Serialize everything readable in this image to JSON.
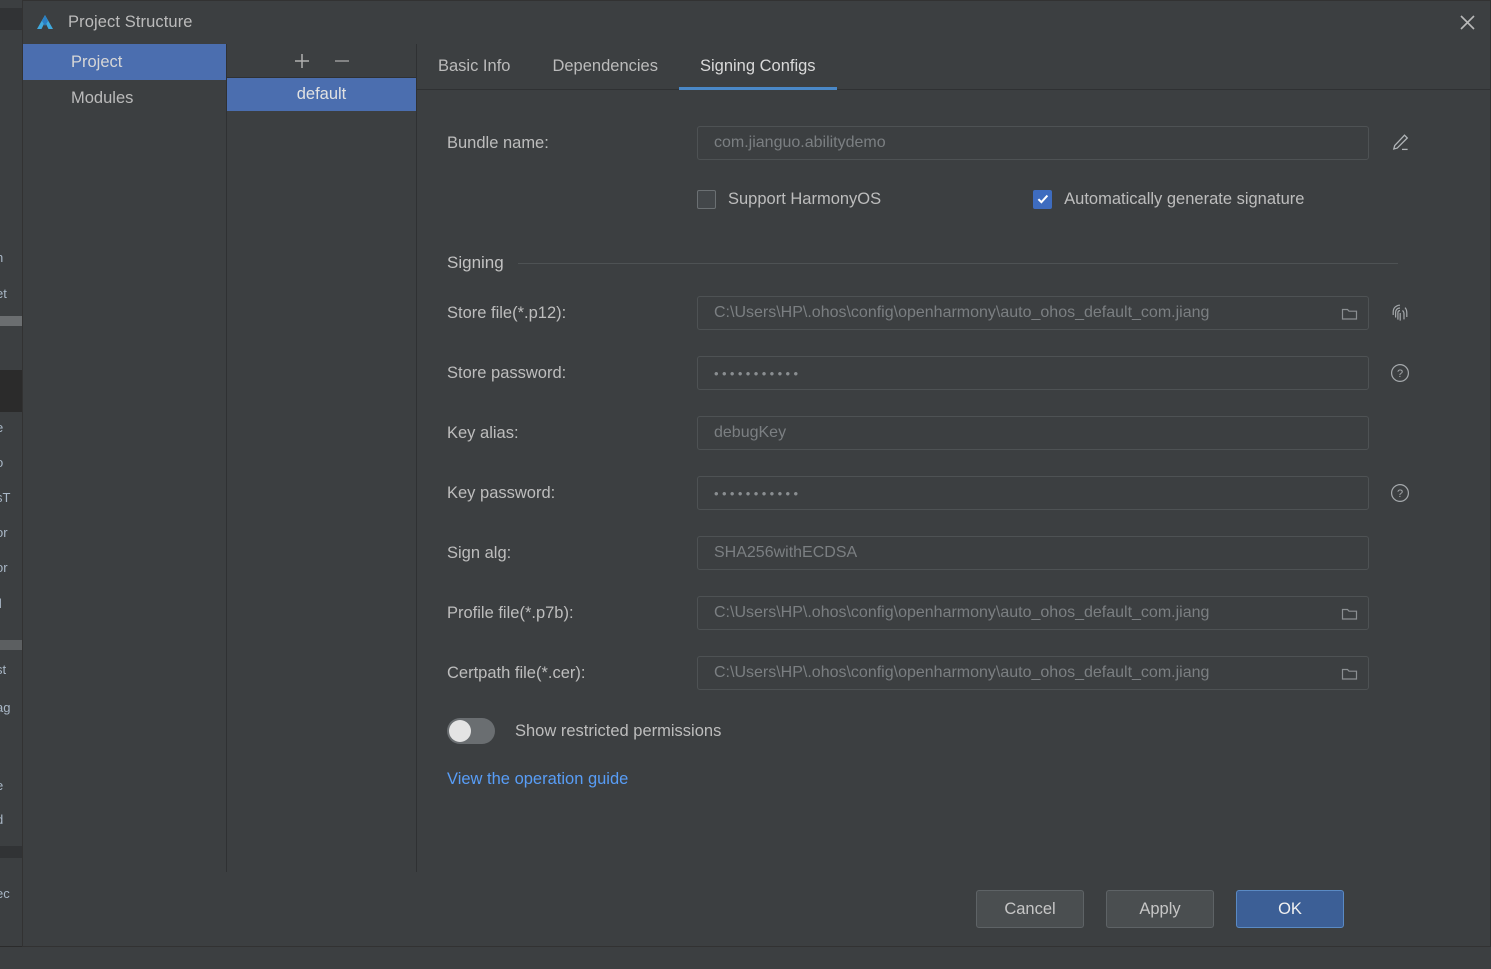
{
  "background": {
    "left_text_fragments": [
      "n",
      "et",
      "•",
      "e",
      "o",
      "sT",
      "or",
      "or",
      "il",
      "st",
      "ag",
      "e",
      "d",
      "ec"
    ],
    "bottom_hint": ""
  },
  "window": {
    "title": "Project Structure",
    "logo_icon": "devtools-logo-icon",
    "close_icon": "close-icon"
  },
  "sidebar": {
    "items": [
      {
        "label": "Project",
        "selected": true
      },
      {
        "label": "Modules",
        "selected": false
      }
    ]
  },
  "configs_panel": {
    "add_icon": "plus-icon",
    "remove_icon": "minus-icon",
    "items": [
      {
        "label": "default",
        "selected": true
      }
    ]
  },
  "tabs": [
    {
      "label": "Basic Info",
      "active": false
    },
    {
      "label": "Dependencies",
      "active": false
    },
    {
      "label": "Signing Configs",
      "active": true
    }
  ],
  "form": {
    "bundle_name": {
      "label": "Bundle name:",
      "value": "com.jianguo.abilitydemo",
      "edit_icon": "pencil-icon"
    },
    "checkboxes": [
      {
        "label": "Support HarmonyOS",
        "checked": false
      },
      {
        "label": "Automatically generate signature",
        "checked": true
      }
    ],
    "signing_section_title": "Signing",
    "rows": [
      {
        "label": "Store file(*.p12):",
        "value": "C:\\Users\\HP\\.ohos\\config\\openharmony\\auto_ohos_default_com.jiang",
        "type": "file",
        "folder_icon": "folder-icon",
        "side_icon": "fingerprint-icon"
      },
      {
        "label": "Store password:",
        "value": "•••••••••••",
        "type": "password",
        "side_icon": "help-circle-icon"
      },
      {
        "label": "Key alias:",
        "value": "debugKey",
        "type": "text",
        "side_icon": ""
      },
      {
        "label": "Key password:",
        "value": "•••••••••••",
        "type": "password",
        "side_icon": "help-circle-icon"
      },
      {
        "label": "Sign alg:",
        "value": "SHA256withECDSA",
        "type": "text",
        "side_icon": ""
      },
      {
        "label": "Profile file(*.p7b):",
        "value": "C:\\Users\\HP\\.ohos\\config\\openharmony\\auto_ohos_default_com.jiang",
        "type": "file",
        "folder_icon": "folder-icon",
        "side_icon": ""
      },
      {
        "label": "Certpath file(*.cer):",
        "value": "C:\\Users\\HP\\.ohos\\config\\openharmony\\auto_ohos_default_com.jiang",
        "type": "file",
        "folder_icon": "folder-icon",
        "side_icon": ""
      }
    ],
    "toggle": {
      "label": "Show restricted permissions",
      "on": false
    },
    "link": "View the operation guide"
  },
  "footer": {
    "cancel": "Cancel",
    "apply": "Apply",
    "ok": "OK"
  },
  "colors": {
    "accent_blue": "#4b6eaf",
    "tab_underline": "#4a88c7",
    "link_blue": "#589df6",
    "checkbox_blue": "#3e6cbf",
    "dialog_bg": "#3c3f41",
    "primary_button": "#3c5f96"
  }
}
